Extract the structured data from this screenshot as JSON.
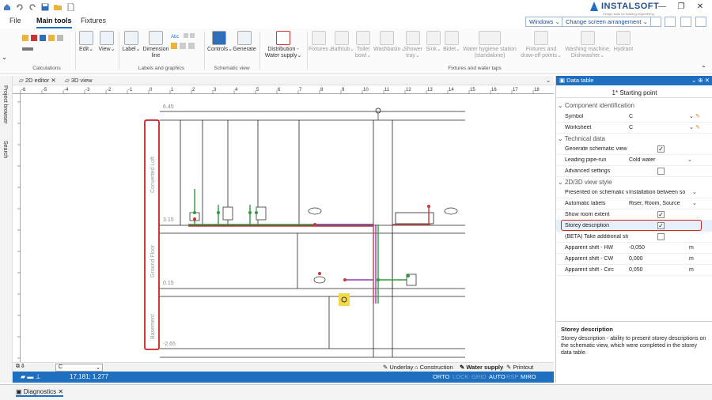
{
  "titlebar": {
    "brand": "INSTALSOFT",
    "tagline": "Design tools for building engineering",
    "quick_icons": [
      "home-icon",
      "undo-icon",
      "redo-icon",
      "save-icon",
      "open-folder-icon",
      "new-file-icon"
    ]
  },
  "tabs": {
    "file": "File",
    "main_tools": "Main tools",
    "fixtures": "Fixtures",
    "windows_dd": "Windows",
    "screen_dd": "Change screen arrangement"
  },
  "ribbon": {
    "calc_group": "Calculations",
    "edit": "Edit",
    "view": "View",
    "label": "Label",
    "dimension_line": "Dimension line",
    "labels_group": "Labels and graphics",
    "controls": "Controls",
    "generate": "Generate",
    "schematic_group": "Schematic view",
    "distribution": "Distribution - Water supply",
    "fixtures": "Fixtures",
    "bathtub": "Bathtub",
    "toilet_bowl": "Toilet bowl",
    "washbasin": "Washbasin",
    "shower_tray": "Shower tray",
    "sink": "Sink",
    "bidet": "Bidet",
    "hygiene_station": "Water hygiene station (standalone)",
    "fixtures_drawoff": "Fixtures and draw-off points",
    "washing_machine": "Washing machine, Dishwasher",
    "hydrant": "Hydrant",
    "fixtures_group": "Fixtures and water taps"
  },
  "doctabs": {
    "editor2d": "2D editor",
    "view3d": "3D view"
  },
  "leftstrip": {
    "project_browser": "Project browser",
    "search": "Search"
  },
  "ruler": {
    "h_ticks": [
      "-6",
      "-5",
      "-4",
      "-3",
      "-2",
      "-1",
      "0",
      "1",
      "2",
      "3",
      "4",
      "5",
      "6",
      "7",
      "8",
      "9",
      "10",
      "11",
      "12",
      "13",
      "14",
      "15",
      "16",
      "17",
      "18"
    ]
  },
  "drawing": {
    "levels": [
      "6.45",
      "3.15",
      "0.15",
      "-2.65"
    ],
    "storeys": [
      "Converted Loft",
      "Ground Floor",
      "Basement"
    ]
  },
  "bottombar": {
    "layer_value": "C",
    "underlay": "Underlay",
    "construction": "Construction",
    "water_supply": "Water supply",
    "printout": "Printout"
  },
  "statusbar": {
    "coords": "17,181; 1,277",
    "ortho": "ORTO",
    "lock": "LOCK",
    "grid": "GRID",
    "auto": "AUTO",
    "rsp": "RSP",
    "miro": "MIRO"
  },
  "diagnostics": {
    "label": "Diagnostics"
  },
  "panel": {
    "title": "Data table",
    "subtitle": "1* Starting point",
    "cat_component": "Component identification",
    "cat_technical": "Technical data",
    "cat_view": "2D/3D view style",
    "rows": [
      {
        "k": "Symbol",
        "v": "C"
      },
      {
        "k": "Worksheet",
        "v": "C"
      },
      {
        "k": "Generate schematic view",
        "v": ""
      },
      {
        "k": "Leading pipe-run",
        "v": "Cold water"
      },
      {
        "k": "Advanced settings",
        "v": ""
      },
      {
        "k": "Presented on schematic v",
        "v": "Installation between so"
      },
      {
        "k": "Automatic labels",
        "v": "Riser, Room, Source"
      },
      {
        "k": "Show room extent",
        "v": ""
      },
      {
        "k": "Storey description",
        "v": ""
      },
      {
        "k": "(BETA) Take additional sto",
        "v": ""
      },
      {
        "k": "Apparent shift - HW",
        "v": "-0,050",
        "u": "m"
      },
      {
        "k": "Apparent shift - CW",
        "v": "0,000",
        "u": "m"
      },
      {
        "k": "Apparent shift - Circ",
        "v": "0,050",
        "u": "m"
      }
    ],
    "desc_title": "Storey description",
    "desc_text": "Storey description - ability to present storey descriptions on the schematic view, which were completed in the storey data table."
  },
  "colors": {
    "accent": "#1f6fc0",
    "highlight": "#cc2222",
    "cold_water": "#2e9a3a",
    "hot_water": "#c23b3b",
    "circ": "#8a3fb5"
  }
}
